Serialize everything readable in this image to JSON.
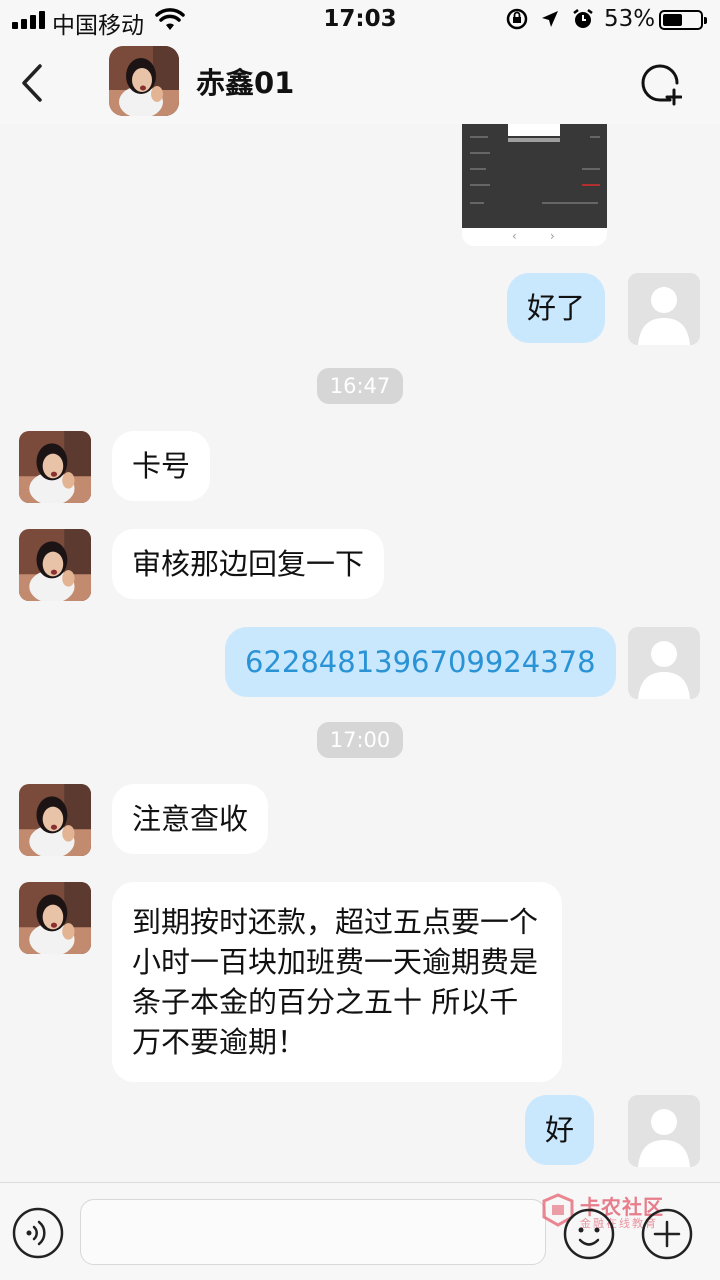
{
  "status_bar": {
    "carrier": "中国移动",
    "time": "17:03",
    "battery_percent": "53%",
    "battery_level": 0.53
  },
  "header": {
    "title": "赤鑫01",
    "back_icon": "chevron-left-icon",
    "add_member_icon": "chat-add-icon"
  },
  "chat": {
    "shared_image": {
      "nav_prev": "‹",
      "nav_next": "›"
    },
    "messages": [
      {
        "type": "text",
        "direction": "out",
        "text": "好了"
      },
      {
        "type": "time",
        "text": "16:47"
      },
      {
        "type": "text",
        "direction": "in",
        "text": "卡号"
      },
      {
        "type": "text",
        "direction": "in",
        "text": "审核那边回复一下"
      },
      {
        "type": "text",
        "direction": "out",
        "text": "6228481396709924378"
      },
      {
        "type": "time",
        "text": "17:00"
      },
      {
        "type": "text",
        "direction": "in",
        "text": "注意查收"
      },
      {
        "type": "text",
        "direction": "in",
        "text": "到期按时还款，超过五点要一个小时一百块加班费一天逾期费是条子本金的百分之五十 所以千万不要逾期！"
      },
      {
        "type": "text",
        "direction": "out",
        "text": "好"
      }
    ]
  },
  "input_bar": {
    "placeholder": "",
    "voice_icon": "voice-icon",
    "emoji_icon": "emoji-icon",
    "plus_icon": "plus-icon",
    "watermark_title": "卡农社区",
    "watermark_subtitle": "金融在线教育"
  },
  "colors": {
    "outgoing_bubble": "#c9e7fd",
    "incoming_bubble": "#ffffff",
    "link": "#2a93d5",
    "background": "#f5f5f5"
  }
}
